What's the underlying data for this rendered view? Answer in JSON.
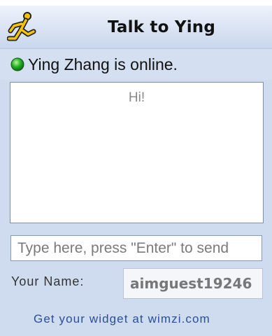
{
  "header": {
    "title": "Talk to Ying",
    "logo_icon": "aim-running-man-icon"
  },
  "status": {
    "text": "Ying Zhang is online.",
    "icon": "online-status-icon",
    "color": "#22b022"
  },
  "chat": {
    "messages": [
      "Hi!"
    ]
  },
  "message_input": {
    "placeholder": "Type here, press \"Enter\" to send",
    "value": ""
  },
  "name_field": {
    "label": "Your Name:",
    "value": "aimguest19246"
  },
  "footer": {
    "link_text": "Get your widget at wimzi.com"
  },
  "colors": {
    "panel_bg": "#cfdbee",
    "link": "#2a4f9c",
    "logo": "#f5c400"
  }
}
